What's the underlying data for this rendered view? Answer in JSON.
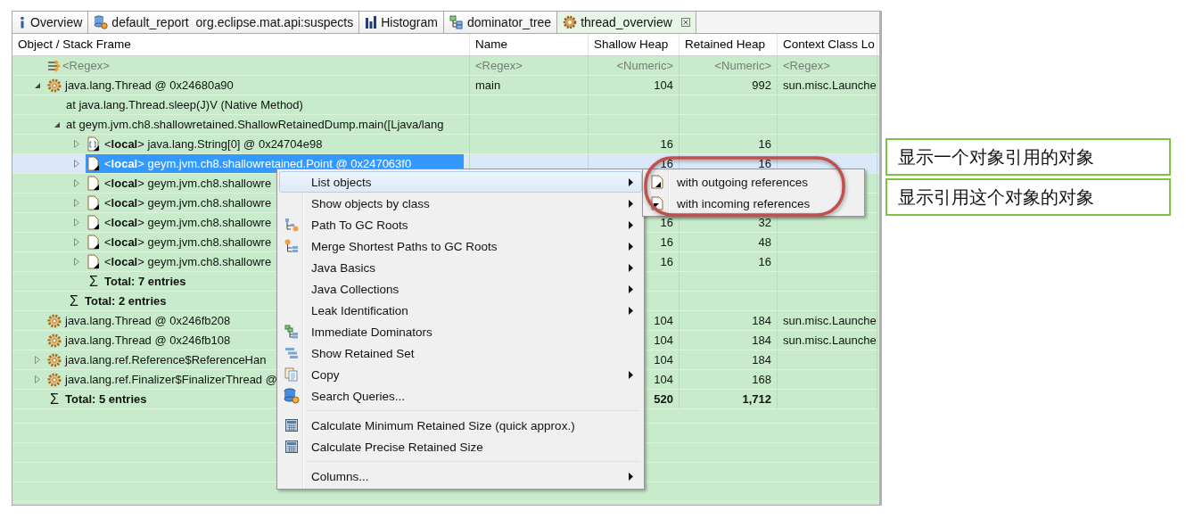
{
  "tabs": [
    {
      "label": "Overview",
      "kind": "info",
      "selected": false,
      "closable": false
    },
    {
      "label": "default_report  org.eclipse.mat.api:suspects",
      "kind": "report",
      "selected": false,
      "closable": false
    },
    {
      "label": "Histogram",
      "kind": "histogram",
      "selected": false,
      "closable": false
    },
    {
      "label": "dominator_tree",
      "kind": "tree",
      "selected": false,
      "closable": false
    },
    {
      "label": "thread_overview",
      "kind": "gear",
      "selected": true,
      "closable": true
    }
  ],
  "table": {
    "columns": [
      "Object / Stack Frame",
      "Name",
      "Shallow Heap",
      "Retained Heap",
      "Context Class Lo"
    ],
    "filter_row": {
      "object": "<Regex>",
      "name": "<Regex>",
      "shallow": "<Numeric>",
      "retained": "<Numeric>",
      "loader": "<Regex>"
    },
    "rows": [
      {
        "kind": "thread",
        "label": "java.lang.Thread @ 0x24680a90",
        "expanded": true,
        "selected": false,
        "name": "main",
        "shallow": "104",
        "retained": "992",
        "loader": "sun.misc.Launche",
        "children": [
          {
            "kind": "frame",
            "label": "at java.lang.Thread.sleep(J)V (Native Method)",
            "selected": false
          },
          {
            "kind": "frame",
            "label": "at geym.jvm.ch8.shallowretained.ShallowRetainedDump.main([Ljava/lang",
            "expanded": true,
            "selected": false,
            "children": [
              {
                "kind": "array",
                "label": "<**local**> java.lang.String[0] @ 0x24704e98",
                "expanded": false,
                "selected": false,
                "shallow": "16",
                "retained": "16"
              },
              {
                "kind": "local",
                "label": "<**local**> geym.jvm.ch8.shallowretained.Point @ 0x247063f0",
                "expanded": false,
                "selected": true,
                "shallow": "16",
                "retained": "16"
              },
              {
                "kind": "local",
                "label": "<**local**> geym.jvm.ch8.shallowre",
                "expanded": false,
                "selected": false
              },
              {
                "kind": "local",
                "label": "<**local**> geym.jvm.ch8.shallowre",
                "expanded": false,
                "selected": false
              },
              {
                "kind": "local",
                "label": "<**local**> geym.jvm.ch8.shallowre",
                "expanded": false,
                "selected": false,
                "shallow": "16",
                "retained": "32"
              },
              {
                "kind": "local",
                "label": "<**local**> geym.jvm.ch8.shallowre",
                "expanded": false,
                "selected": false,
                "shallow": "16",
                "retained": "48"
              },
              {
                "kind": "local",
                "label": "<**local**> geym.jvm.ch8.shallowre",
                "expanded": false,
                "selected": false,
                "shallow": "16",
                "retained": "16"
              },
              {
                "kind": "total",
                "symbol": "Σ",
                "label": "Total: 7 entries",
                "selected": false
              }
            ]
          },
          {
            "kind": "total",
            "symbol": "Σ",
            "label": "Total: 2 entries",
            "selected": false
          }
        ]
      },
      {
        "kind": "thread",
        "label": "java.lang.Thread @ 0x246fb208",
        "selected": false,
        "shallow": "104",
        "retained": "184",
        "loader": "sun.misc.Launche"
      },
      {
        "kind": "thread",
        "label": "java.lang.Thread @ 0x246fb108",
        "selected": false,
        "shallow": "104",
        "retained": "184",
        "loader": "sun.misc.Launche"
      },
      {
        "kind": "thread",
        "label": "java.lang.ref.Reference$ReferenceHan",
        "expanded": false,
        "selected": false,
        "shallow": "104",
        "retained": "184"
      },
      {
        "kind": "thread",
        "label": "java.lang.ref.Finalizer$FinalizerThread @",
        "expanded": false,
        "selected": false,
        "shallow": "104",
        "retained": "168"
      },
      {
        "kind": "total",
        "symbol": "Σ",
        "label": "Total: 5 entries",
        "selected": false,
        "shallow": "520",
        "retained": "1,712"
      }
    ]
  },
  "context_menu": {
    "groups": [
      [
        {
          "label": "List objects",
          "kind": "plain",
          "submenu": true,
          "selected": true
        },
        {
          "label": "Show objects by class",
          "kind": "plain",
          "submenu": true,
          "selected": false
        },
        {
          "label": "Path To GC Roots",
          "kind": "path",
          "submenu": true,
          "selected": false
        },
        {
          "label": "Merge Shortest Paths to GC Roots",
          "kind": "merge",
          "submenu": true,
          "selected": false
        },
        {
          "label": "Java Basics",
          "kind": "plain",
          "submenu": true,
          "selected": false
        },
        {
          "label": "Java Collections",
          "kind": "plain",
          "submenu": true,
          "selected": false
        },
        {
          "label": "Leak Identification",
          "kind": "plain",
          "submenu": true,
          "selected": false
        },
        {
          "label": "Immediate Dominators",
          "kind": "dominators",
          "submenu": false,
          "selected": false
        },
        {
          "label": "Show Retained Set",
          "kind": "retained",
          "submenu": false,
          "selected": false
        },
        {
          "label": "Copy",
          "kind": "copy",
          "submenu": true,
          "selected": false
        },
        {
          "label": "Search Queries...",
          "kind": "query",
          "submenu": false,
          "selected": false
        }
      ],
      [
        {
          "label": "Calculate Minimum Retained Size (quick approx.)",
          "kind": "calc",
          "submenu": false,
          "selected": false
        },
        {
          "label": "Calculate Precise Retained Size",
          "kind": "calc",
          "submenu": false,
          "selected": false
        }
      ],
      [
        {
          "label": "Columns...",
          "kind": "plain",
          "submenu": true,
          "selected": false
        }
      ]
    ]
  },
  "submenu": {
    "items": [
      {
        "label": "with outgoing references",
        "kind": "outgoing",
        "selected": false
      },
      {
        "label": "with incoming references",
        "kind": "incoming",
        "selected": false
      }
    ]
  },
  "annotations": [
    {
      "text": "显示一个对象引用的对象"
    },
    {
      "text": "显示引用这个对象的对象"
    }
  ]
}
